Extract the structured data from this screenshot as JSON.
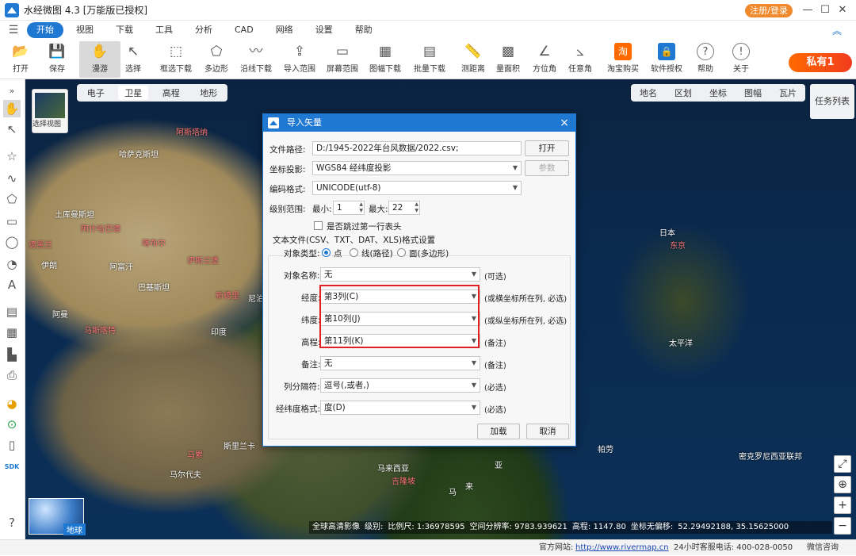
{
  "window": {
    "title": "水经微图 4.3 [万能版已授权]",
    "login_label": "注册/登录",
    "controls": [
      "—",
      "☐",
      "✕"
    ]
  },
  "menu": {
    "items": [
      "开始",
      "视图",
      "下载",
      "工具",
      "分析",
      "CAD",
      "网络",
      "设置",
      "帮助"
    ]
  },
  "toolbar": {
    "items": [
      {
        "label": "打开",
        "icon": "folder-open-icon",
        "glyph": "📂"
      },
      {
        "label": "保存",
        "icon": "save-icon",
        "glyph": "💾"
      },
      {
        "label": "漫游",
        "icon": "hand-icon",
        "glyph": "✋"
      },
      {
        "label": "选择",
        "icon": "cursor-icon",
        "glyph": "↖"
      },
      {
        "label": "框选下载",
        "icon": "rect-download-icon",
        "glyph": "⬚"
      },
      {
        "label": "多边形",
        "icon": "polygon-icon",
        "glyph": "⬠"
      },
      {
        "label": "沿线下载",
        "icon": "line-download-icon",
        "glyph": "〰"
      },
      {
        "label": "导入范围",
        "icon": "import-range-icon",
        "glyph": "⇪"
      },
      {
        "label": "屏幕范围",
        "icon": "screen-range-icon",
        "glyph": "▭"
      },
      {
        "label": "图幅下载",
        "icon": "sheet-download-icon",
        "glyph": "▦"
      },
      {
        "label": "批量下载",
        "icon": "batch-download-icon",
        "glyph": "▤"
      },
      {
        "label": "测距离",
        "icon": "ruler-icon",
        "glyph": "📏"
      },
      {
        "label": "量面积",
        "icon": "area-icon",
        "glyph": "▩"
      },
      {
        "label": "方位角",
        "icon": "azimuth-icon",
        "glyph": "∠"
      },
      {
        "label": "任意角",
        "icon": "angle-icon",
        "glyph": "⦣"
      },
      {
        "label": "淘宝购买",
        "icon": "taobao-icon",
        "glyph": "淘"
      },
      {
        "label": "软件授权",
        "icon": "license-icon",
        "glyph": "🔒"
      },
      {
        "label": "帮助",
        "icon": "help-icon",
        "glyph": "?"
      },
      {
        "label": "关于",
        "icon": "info-icon",
        "glyph": "!"
      }
    ],
    "private_label": "私有1"
  },
  "map": {
    "basemap_tabs": [
      "电子",
      "卫星",
      "高程",
      "地形"
    ],
    "layer_thumb_label": "选择视图",
    "right_tabs": [
      "地名",
      "区划",
      "坐标",
      "图幅",
      "瓦片"
    ],
    "task_list": "任务列表",
    "globe_label": "地球",
    "labels": [
      {
        "text": "哈萨克斯坦",
        "cls": ""
      },
      {
        "text": "阿斯塔纳",
        "cls": "red"
      },
      {
        "text": "土库曼斯坦",
        "cls": ""
      },
      {
        "text": "阿什哈巴德",
        "cls": "red"
      },
      {
        "text": "德黑兰",
        "cls": "red"
      },
      {
        "text": "喀布尔",
        "cls": "red"
      },
      {
        "text": "伊斯兰堡",
        "cls": "red"
      },
      {
        "text": "伊朗",
        "cls": ""
      },
      {
        "text": "阿富汗",
        "cls": ""
      },
      {
        "text": "巴基斯坦",
        "cls": ""
      },
      {
        "text": "新德里",
        "cls": "red"
      },
      {
        "text": "尼泊",
        "cls": ""
      },
      {
        "text": "阿曼",
        "cls": ""
      },
      {
        "text": "马斯喀特",
        "cls": "red"
      },
      {
        "text": "印度",
        "cls": ""
      },
      {
        "text": "斯里兰卡",
        "cls": ""
      },
      {
        "text": "马尔代夫",
        "cls": ""
      },
      {
        "text": "马累",
        "cls": "red"
      },
      {
        "text": "日本",
        "cls": ""
      },
      {
        "text": "东京",
        "cls": "red"
      },
      {
        "text": "太平洋",
        "cls": ""
      },
      {
        "text": "帕劳",
        "cls": ""
      },
      {
        "text": "密克罗尼西亚联邦",
        "cls": ""
      },
      {
        "text": "马来西亚",
        "cls": ""
      },
      {
        "text": "吉隆坡",
        "cls": "red"
      },
      {
        "text": "亚",
        "cls": ""
      },
      {
        "text": "来",
        "cls": ""
      },
      {
        "text": "马",
        "cls": ""
      }
    ],
    "status": [
      "全球高清影像",
      "级别:",
      "比例尺: 1:36978595",
      "空间分辨率: 9783.939621",
      "高程: 1147.80",
      "坐标无偏移:",
      "52.29492188, 35.15625000"
    ]
  },
  "statusbar": {
    "site_label": "官方网站:",
    "site_url": "http://www.rivermap.cn",
    "hotline": "24小时客服电话: 400-028-0050",
    "wechat": "微信咨询"
  },
  "dialog": {
    "title": "导入矢量",
    "file_path_label": "文件路径:",
    "file_path": "D:/1945-2022年台风数据/2022.csv;",
    "open_btn": "打开",
    "projection_label": "坐标投影:",
    "projection": "WGS84 经纬度投影",
    "params_btn": "参数",
    "encoding_label": "编码格式:",
    "encoding": "UNICODE(utf-8)",
    "level_label": "级别范围:",
    "min_label": "最小:",
    "min_value": "1",
    "max_label": "最大:",
    "max_value": "22",
    "skip_header_label": "是否跳过第一行表头",
    "group_label": "文本文件(CSV、TXT、DAT、XLS)格式设置",
    "object_type_label": "对象类型:",
    "type_point": "点",
    "type_line": "线(路径)",
    "type_polygon": "面(多边形)",
    "object_name_label": "对象名称:",
    "object_name": "无",
    "object_name_note": "(可选)",
    "lon_label": "经度:",
    "lon_value": "第3列(C)",
    "lon_note": "(或横坐标所在列, 必选)",
    "lat_label": "纬度:",
    "lat_value": "第10列(J)",
    "lat_note": "(或纵坐标所在列, 必选)",
    "elev_label": "高程:",
    "elev_value": "第11列(K)",
    "elev_note": "(备注)",
    "remark_label": "备注:",
    "remark_value": "无",
    "remark_note": "(备注)",
    "sep_label": "列分隔符:",
    "sep_value": "逗号(,或者,)",
    "sep_note": "(必选)",
    "lonlat_format_label": "经纬度格式:",
    "lonlat_format_value": "度(D)",
    "lonlat_format_note": "(必选)",
    "load_btn": "加载",
    "cancel_btn": "取消"
  }
}
